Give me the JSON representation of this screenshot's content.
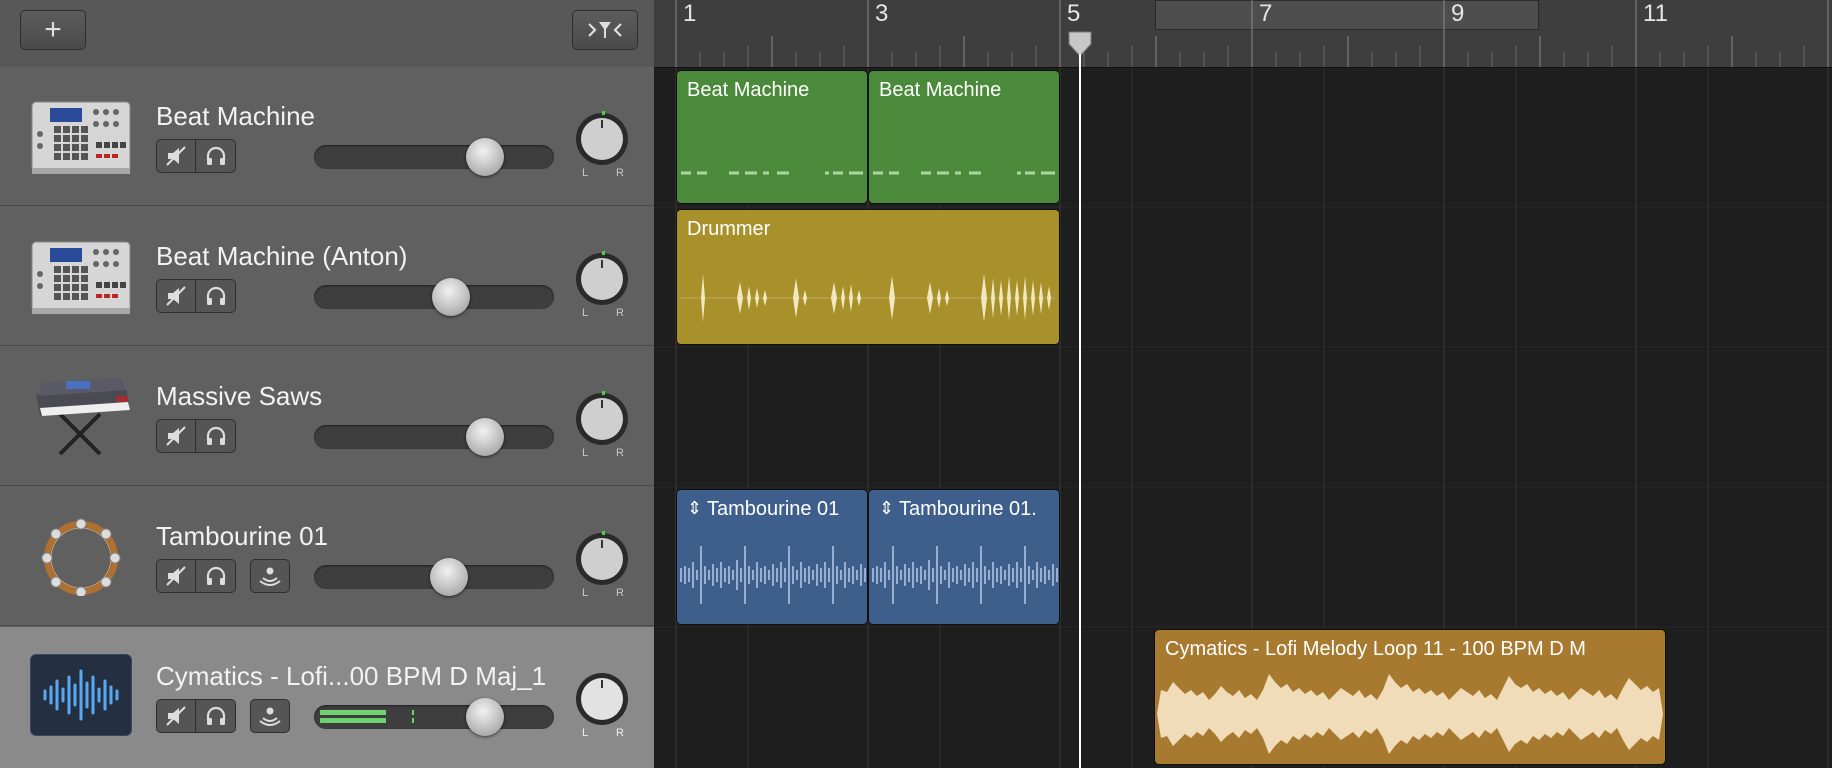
{
  "toolbar": {
    "add_button_label": "+",
    "filter_button_label": ">Y<"
  },
  "ruler": {
    "bars": [
      "1",
      "3",
      "5",
      "7",
      "9",
      "11"
    ]
  },
  "tracks": [
    {
      "name": "Beat Machine",
      "icon": "drum-machine-icon"
    },
    {
      "name": "Beat Machine (Anton)",
      "icon": "drum-machine-icon"
    },
    {
      "name": "Massive Saws",
      "icon": "synthesizer-keyboard-icon"
    },
    {
      "name": "Tambourine 01",
      "icon": "tambourine-icon"
    },
    {
      "name": "Cymatics - Lofi...00 BPM D Maj_1",
      "icon": "audio-waveform-icon"
    }
  ],
  "pan_labels": {
    "left": "L",
    "right": "R"
  },
  "regions": {
    "beat1": "Beat Machine",
    "beat2": "Beat Machine",
    "drummer": "Drummer",
    "tamb1": "Tambourine 01",
    "tamb2": "Tambourine 01.",
    "cymatics": "Cymatics - Lofi Melody Loop 11 - 100 BPM D M"
  },
  "colors": {
    "beat_region": "#4a8a3a",
    "drummer_region": "#a8902a",
    "tambourine_region": "#3e5e8c",
    "cymatics_region": "#a87a30",
    "playhead": "#ffffff"
  }
}
